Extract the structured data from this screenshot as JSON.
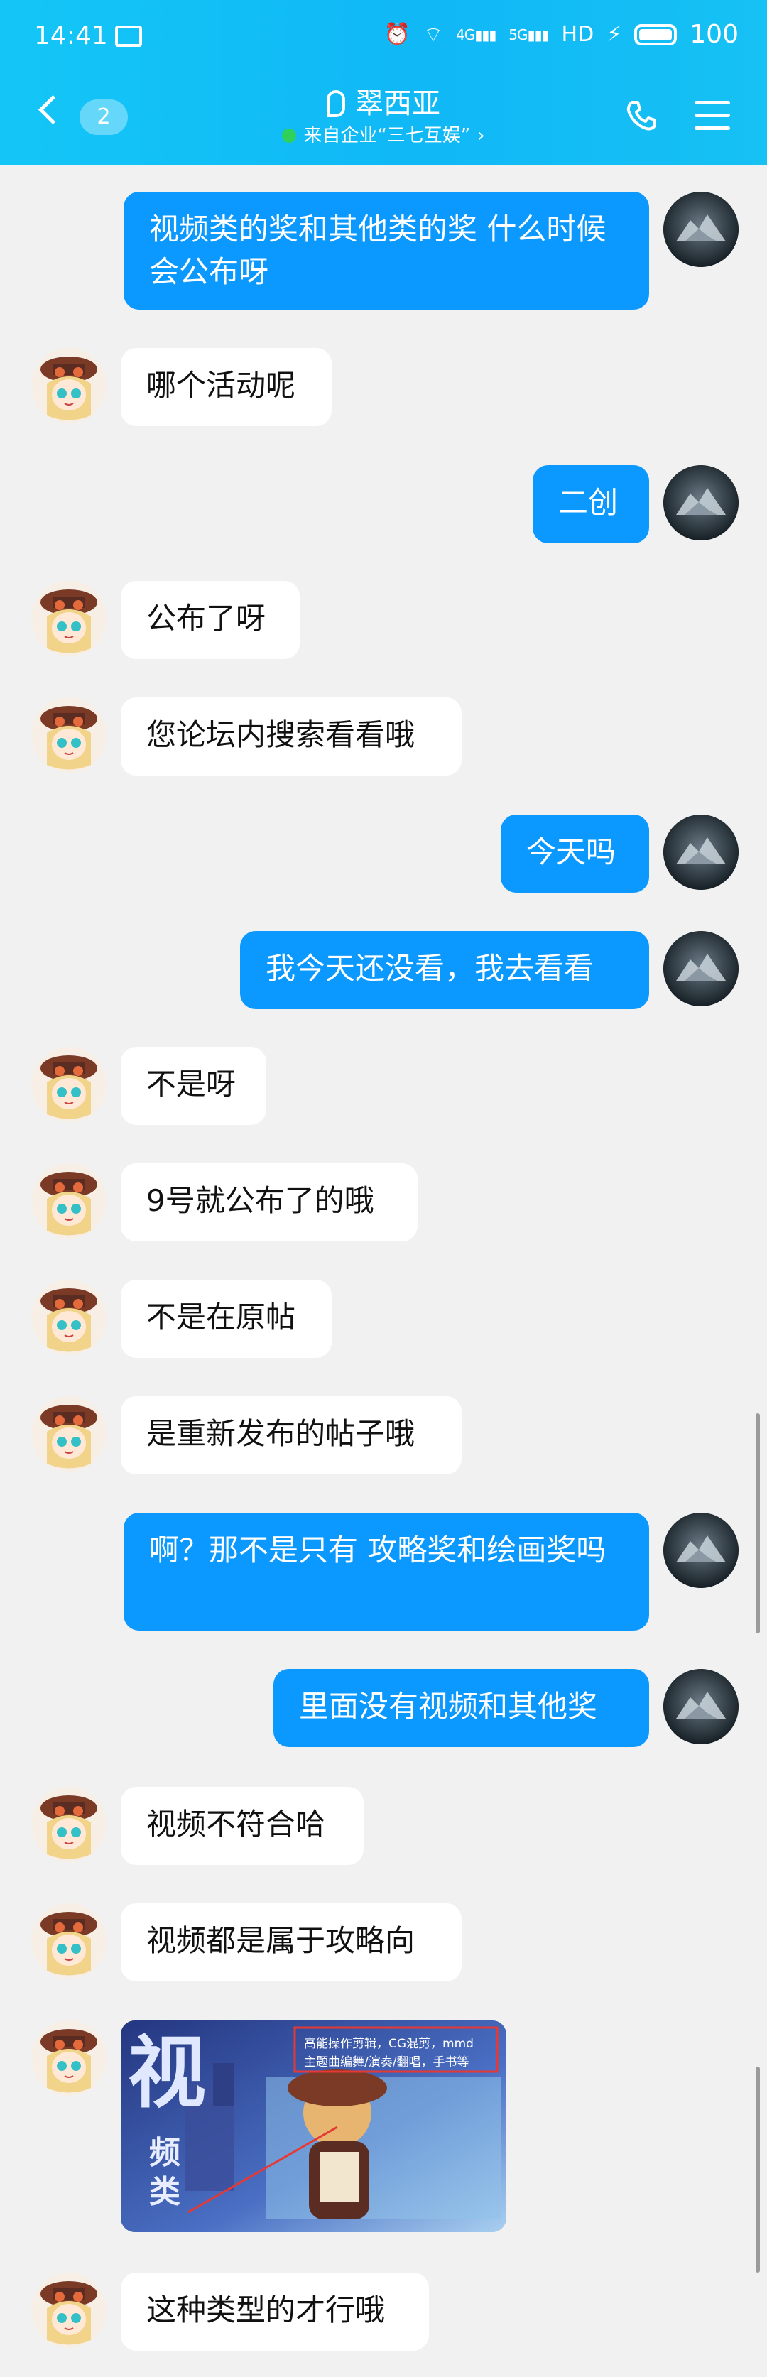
{
  "status_bar": {
    "time": "14:41",
    "network_label": "HD",
    "battery": "100"
  },
  "header": {
    "unread_count": "2",
    "title": "翠西亚",
    "subtitle": "来自企业“三七互娱”"
  },
  "messages": [
    {
      "side": "out",
      "text": "视频类的奖和其他类的奖 什么时候会公布呀"
    },
    {
      "side": "in",
      "text": "哪个活动呢"
    },
    {
      "side": "out",
      "text": "二创"
    },
    {
      "side": "in",
      "text": "公布了呀"
    },
    {
      "side": "in",
      "text": "您论坛内搜索看看哦"
    },
    {
      "side": "out",
      "text": "今天吗"
    },
    {
      "side": "out",
      "text": "我今天还没看，我去看看"
    },
    {
      "side": "in",
      "text": "不是呀"
    },
    {
      "side": "in",
      "text": "9号就公布了的哦"
    },
    {
      "side": "in",
      "text": "不是在原帖"
    },
    {
      "side": "in",
      "text": "是重新发布的帖子哦"
    },
    {
      "side": "out",
      "text": "啊？那不是只有 攻略奖和绘画奖吗"
    },
    {
      "side": "out",
      "text": "里面没有视频和其他奖"
    },
    {
      "side": "in",
      "text": "视频不符合哈"
    },
    {
      "side": "in",
      "text": "视频都是属于攻略向"
    },
    {
      "side": "in",
      "type": "image"
    },
    {
      "side": "in",
      "text": "这种类型的才行哦"
    }
  ],
  "image_message": {
    "big_char": "视",
    "small_chars": [
      "频",
      "类"
    ],
    "caption_line1": "高能操作剪辑，CG混剪，mmd",
    "caption_line2": "主题曲编舞/演奏/翻唱，手书等"
  },
  "colors": {
    "header_bg": "#12bdf6",
    "out_bubble": "#0b99ff",
    "in_bubble": "#ffffff",
    "page_bg": "#f1f1f1"
  }
}
